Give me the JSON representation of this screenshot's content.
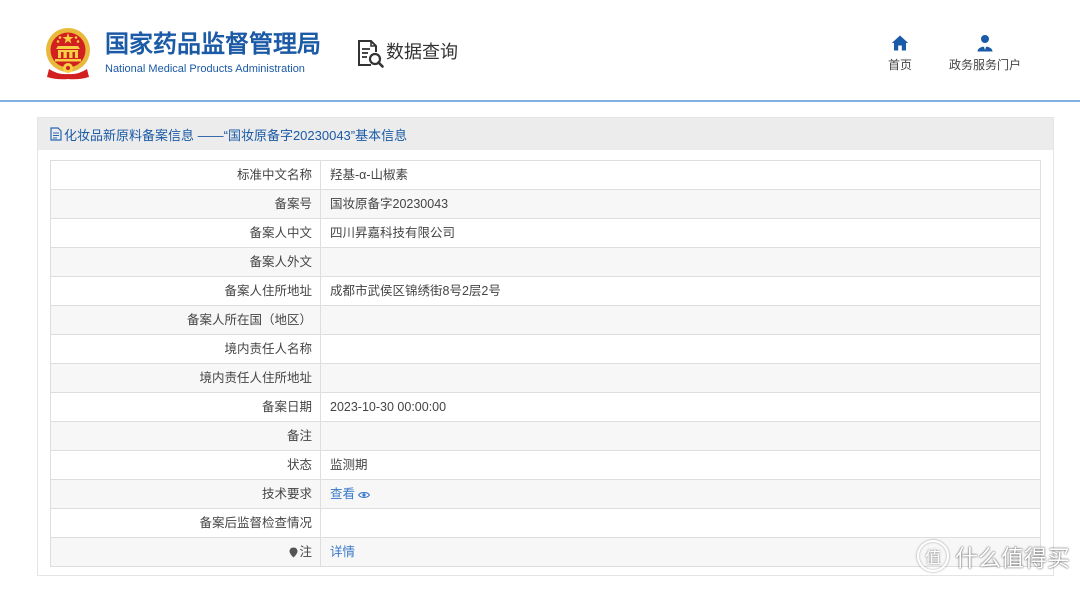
{
  "header": {
    "org_name_cn": "国家药品监督管理局",
    "org_name_en": "National Medical Products Administration",
    "module_title": "数据查询",
    "module_icon": "data-query-icon",
    "nav": [
      {
        "label": "首页",
        "icon": "home-icon"
      },
      {
        "label": "政务服务门户",
        "icon": "user-icon"
      }
    ]
  },
  "panel": {
    "title_icon": "document-icon",
    "title": "化妆品新原料备案信息 ——“国妆原备字20230043”基本信息",
    "rows": [
      {
        "label": "标准中文名称",
        "value": "羟基-α-山椒素"
      },
      {
        "label": "备案号",
        "value": "国妆原备字20230043"
      },
      {
        "label": "备案人中文",
        "value": "四川昇嘉科技有限公司"
      },
      {
        "label": "备案人外文",
        "value": ""
      },
      {
        "label": "备案人住所地址",
        "value": "成都市武侯区锦绣街8号2层2号"
      },
      {
        "label": "备案人所在国（地区）",
        "value": ""
      },
      {
        "label": "境内责任人名称",
        "value": ""
      },
      {
        "label": "境内责任人住所地址",
        "value": ""
      },
      {
        "label": "备案日期",
        "value": "2023-10-30 00:00:00"
      },
      {
        "label": "备注",
        "value": ""
      },
      {
        "label": "状态",
        "value": "监测期"
      },
      {
        "label": "技术要求",
        "value": "查看",
        "is_link": true,
        "value_icon": "eye-icon"
      },
      {
        "label": "备案后监督检查情况",
        "value": ""
      },
      {
        "label": "注",
        "value": "详情",
        "is_link": true,
        "label_icon": "pin-icon"
      }
    ]
  },
  "watermark": {
    "logo_char": "值",
    "text": "什么值得买"
  },
  "colors": {
    "brand_blue": "#1b5aa6",
    "link_blue": "#3a78c9",
    "divider_blue": "#7fb2e3",
    "panel_header_bg": "#ececec"
  }
}
